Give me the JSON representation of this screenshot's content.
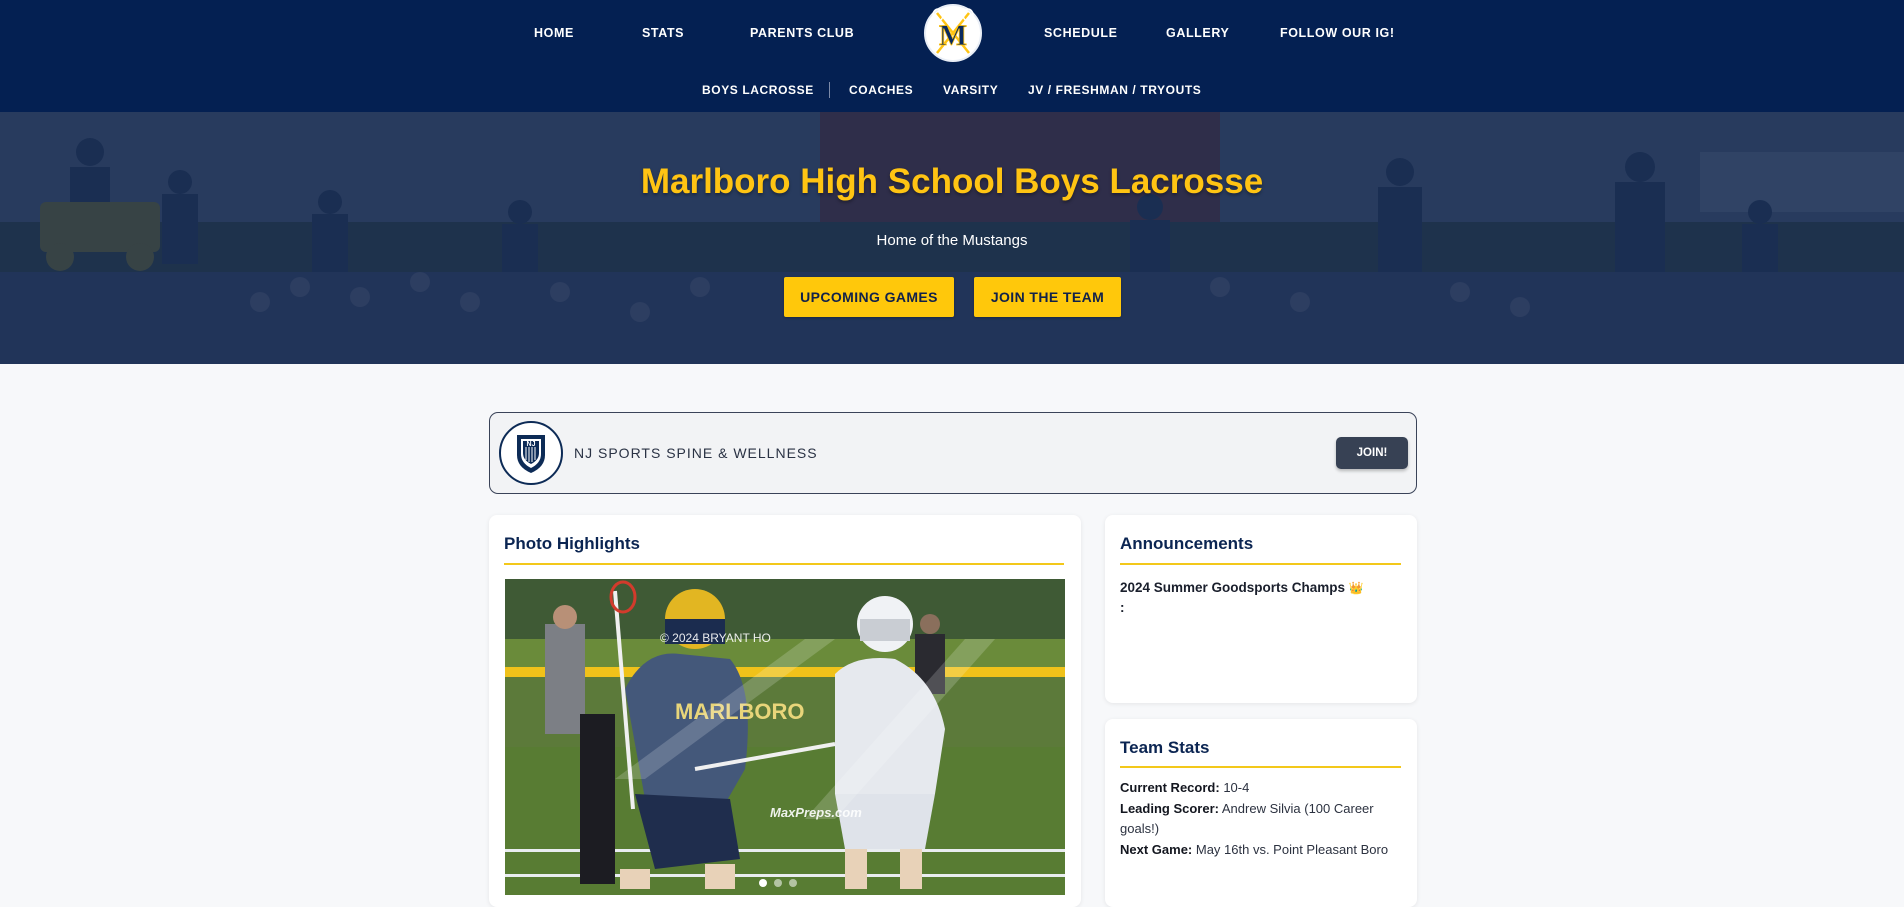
{
  "nav": {
    "items": [
      "HOME",
      "STATS",
      "PARENTS CLUB",
      "SCHEDULE",
      "GALLERY",
      "FOLLOW OUR IG!"
    ],
    "sub_items": [
      "BOYS LACROSSE",
      "COACHES",
      "VARSITY",
      "JV / FRESHMAN / TRYOUTS"
    ],
    "logo_letter": "M"
  },
  "hero": {
    "title": "Marlboro High School Boys Lacrosse",
    "subtitle": "Home of the Mustangs",
    "buttons": [
      "UPCOMING GAMES",
      "JOIN THE TEAM"
    ]
  },
  "sponsor": {
    "name": "NJ SPORTS SPINE & WELLNESS",
    "join_label": "JOIN!",
    "logo_text": "NJ"
  },
  "photo_highlights": {
    "title": "Photo Highlights",
    "watermark": "© 2024 BRYANT HO",
    "credit": "MaxPreps.com",
    "jersey_text": "MARLBORO",
    "slides": 3,
    "active_slide": 1
  },
  "announcements": {
    "title": "Announcements",
    "text": "2024 Summer Goodsports Champs",
    "emoji": "👑",
    "trailing": ":"
  },
  "team_stats": {
    "title": "Team Stats",
    "rows": [
      {
        "label": "Current Record:",
        "value": "10-4"
      },
      {
        "label": "Leading Scorer:",
        "value": "Andrew Silvia (100 Career goals!)"
      },
      {
        "label": "Next Game:",
        "value": "May 16th vs. Point Pleasant Boro"
      }
    ]
  },
  "colors": {
    "navy": "#042052",
    "gold": "#ffc413",
    "button_gold": "#ffc80b",
    "page_bg": "#f7f8fa",
    "join_button": "#374154"
  }
}
